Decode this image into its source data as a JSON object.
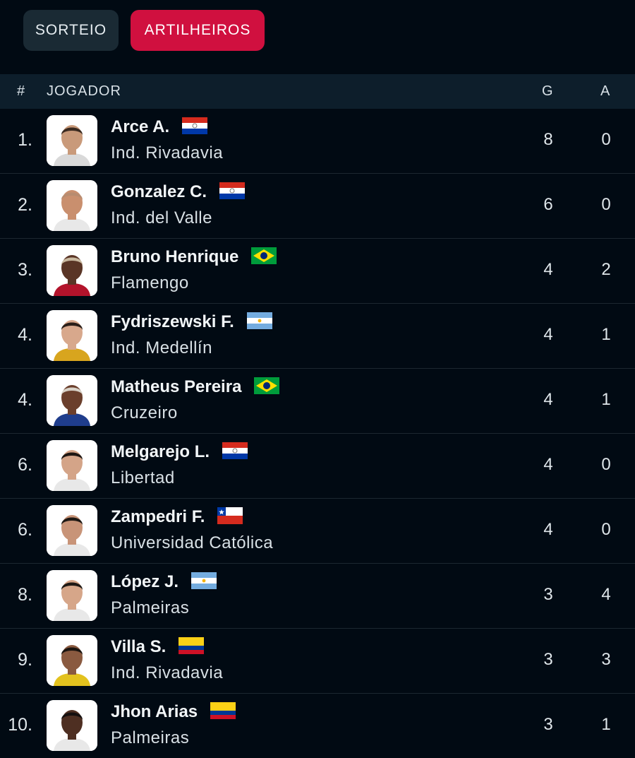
{
  "tabs": [
    {
      "label": "SORTEIO",
      "active": false
    },
    {
      "label": "ARTILHEIROS",
      "active": true
    }
  ],
  "table": {
    "headers": {
      "rank": "#",
      "player": "JOGADOR",
      "goals": "G",
      "assists": "A"
    },
    "rows": [
      {
        "rank": "1.",
        "name": "Arce A.",
        "team": "Ind. Rivadavia",
        "flag": "paraguay-flag-icon",
        "goals": "8",
        "assists": "0",
        "skin": "#c99a7a",
        "hair": "#3a2a20",
        "shirt": "#d9d9d9"
      },
      {
        "rank": "2.",
        "name": "Gonzalez C.",
        "team": "Ind. del Valle",
        "flag": "paraguay-flag-icon",
        "goals": "6",
        "assists": "0",
        "skin": "#c98f6e",
        "hair": "#b88c70",
        "shirt": "#e8e8e8"
      },
      {
        "rank": "3.",
        "name": "Bruno Henrique",
        "team": "Flamengo",
        "flag": "brazil-flag-icon",
        "goals": "4",
        "assists": "2",
        "skin": "#5a3526",
        "hair": "#c9b9a0",
        "shirt": "#b3132b"
      },
      {
        "rank": "4.",
        "name": "Fydriszewski F.",
        "team": "Ind. Medellín",
        "flag": "argentina-flag-icon",
        "goals": "4",
        "assists": "1",
        "skin": "#d8a88c",
        "hair": "#2a1e18",
        "shirt": "#d8a51e"
      },
      {
        "rank": "4.",
        "name": "Matheus Pereira",
        "team": "Cruzeiro",
        "flag": "brazil-flag-icon",
        "goals": "4",
        "assists": "1",
        "skin": "#6b3f2c",
        "hair": "#d8d2c8",
        "shirt": "#1f3d8c"
      },
      {
        "rank": "6.",
        "name": "Melgarejo L.",
        "team": "Libertad",
        "flag": "paraguay-flag-icon",
        "goals": "4",
        "assists": "0",
        "skin": "#d4a488",
        "hair": "#1e1612",
        "shirt": "#e8e8e8"
      },
      {
        "rank": "6.",
        "name": "Zampedri F.",
        "team": "Universidad Católica",
        "flag": "chile-flag-icon",
        "goals": "4",
        "assists": "0",
        "skin": "#c89478",
        "hair": "#1e1814",
        "shirt": "#e8e8e8"
      },
      {
        "rank": "8.",
        "name": "López J.",
        "team": "Palmeiras",
        "flag": "argentina-flag-icon",
        "goals": "3",
        "assists": "4",
        "skin": "#d6a689",
        "hair": "#1f1915",
        "shirt": "#e8e8e8"
      },
      {
        "rank": "9.",
        "name": "Villa S.",
        "team": "Ind. Rivadavia",
        "flag": "colombia-flag-icon",
        "goals": "3",
        "assists": "3",
        "skin": "#8a5a40",
        "hair": "#1a1410",
        "shirt": "#e3c21e"
      },
      {
        "rank": "10.",
        "name": "Jhon Arias",
        "team": "Palmeiras",
        "flag": "colombia-flag-icon",
        "goals": "3",
        "assists": "1",
        "skin": "#4e2f22",
        "hair": "#151010",
        "shirt": "#e8e8e8"
      }
    ]
  },
  "colors": {
    "background": "#010a13",
    "header_bg": "#0d1e2b",
    "active_tab": "#d0103f",
    "inactive_tab": "#1a2a34"
  }
}
